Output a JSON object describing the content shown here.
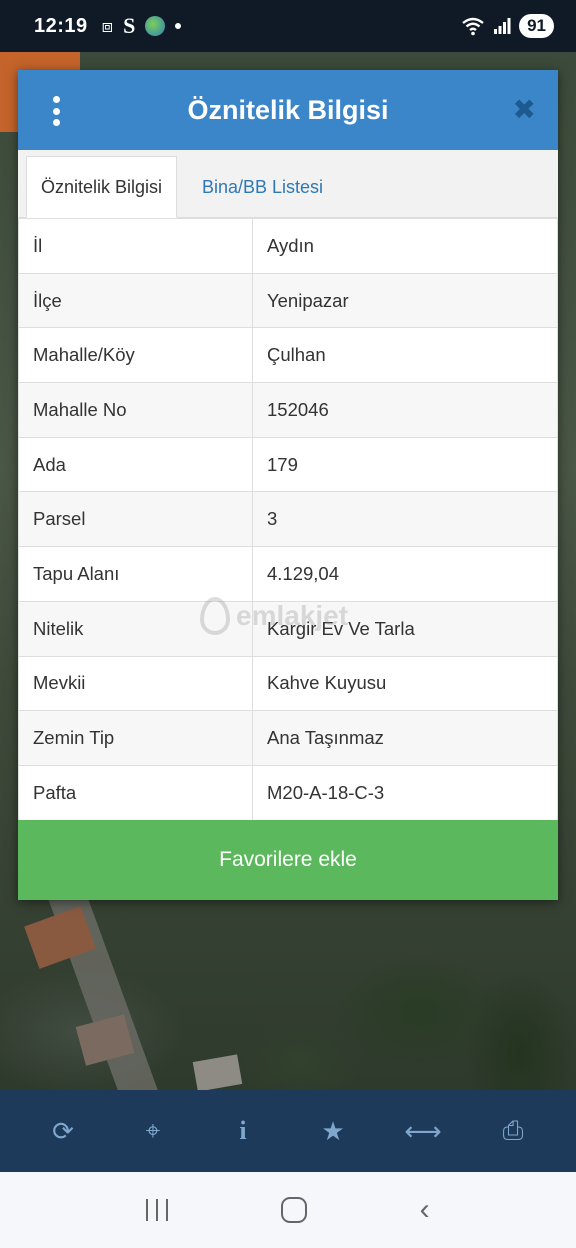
{
  "status_bar": {
    "time": "12:19",
    "battery": "91",
    "icons": [
      "screenshot-icon",
      "s-app-icon",
      "globe-app-icon",
      "notification-dot",
      "wifi-icon",
      "signal-icon"
    ]
  },
  "dialog": {
    "title": "Öznitelik Bilgisi",
    "close_symbol": "✖",
    "tabs": [
      {
        "label": "Öznitelik Bilgisi",
        "active": true
      },
      {
        "label": "Bina/BB Listesi",
        "active": false
      }
    ],
    "rows": [
      {
        "key": "İl",
        "value": "Aydın"
      },
      {
        "key": "İlçe",
        "value": "Yenipazar"
      },
      {
        "key": "Mahalle/Köy",
        "value": "Çulhan"
      },
      {
        "key": "Mahalle No",
        "value": "152046"
      },
      {
        "key": "Ada",
        "value": "179"
      },
      {
        "key": "Parsel",
        "value": "3"
      },
      {
        "key": "Tapu Alanı",
        "value": "4.129,04"
      },
      {
        "key": "Nitelik",
        "value": "Kargir Ev Ve Tarla"
      },
      {
        "key": "Mevkii",
        "value": "Kahve Kuyusu"
      },
      {
        "key": "Zemin Tip",
        "value": "Ana Taşınmaz"
      },
      {
        "key": "Pafta",
        "value": "M20-A-18-C-3"
      }
    ],
    "favorite_button": "Favorilere ekle",
    "watermark": "emlakjet"
  },
  "toolbar": {
    "items": [
      {
        "name": "refresh-icon",
        "glyph": "⟳"
      },
      {
        "name": "locate-icon",
        "glyph": "⌖"
      },
      {
        "name": "info-icon",
        "glyph": "i"
      },
      {
        "name": "star-icon",
        "glyph": "★"
      },
      {
        "name": "measure-icon",
        "glyph": "⟷"
      },
      {
        "name": "print-icon",
        "glyph": "⎙"
      }
    ]
  },
  "colors": {
    "header": "#3a86c8",
    "favorite": "#5cb85c",
    "toolbar": "#1e3a5a",
    "tab_link": "#2e78b7"
  }
}
